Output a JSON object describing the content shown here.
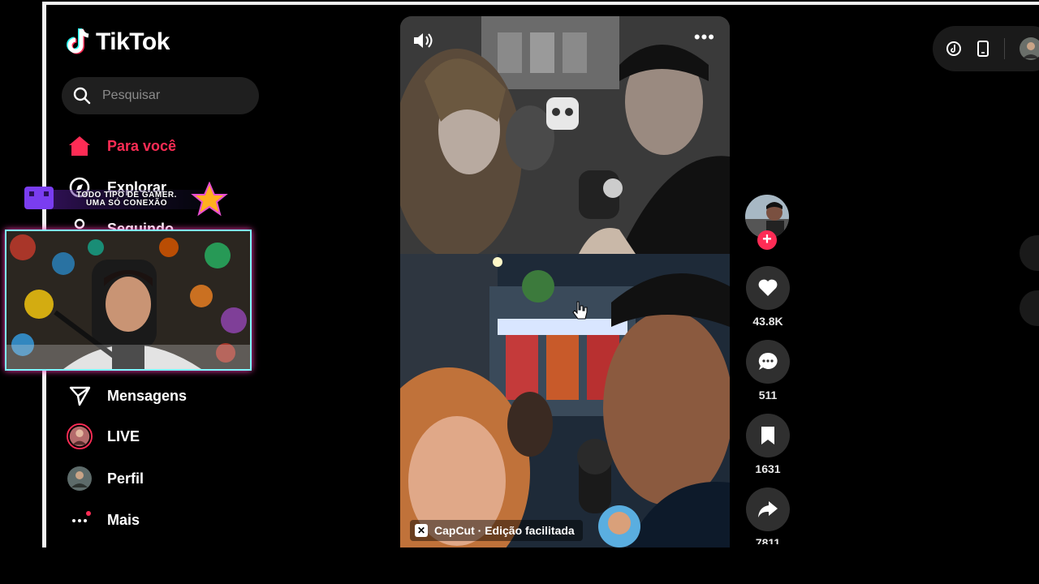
{
  "sidebar": {
    "logo_text": "TikTok",
    "search": {
      "placeholder": "Pesquisar",
      "value": ""
    },
    "items": [
      {
        "label": "Para você",
        "icon": "home-icon",
        "active": true
      },
      {
        "label": "Explorar",
        "icon": "compass-icon"
      },
      {
        "label": "Seguindo",
        "icon": "following-icon"
      },
      {
        "label": "Mensagens",
        "icon": "send-icon"
      },
      {
        "label": "LIVE",
        "icon": "live-avatar"
      },
      {
        "label": "Perfil",
        "icon": "profile-avatar"
      },
      {
        "label": "Mais",
        "icon": "more-dots-icon"
      }
    ]
  },
  "video": {
    "watermark": "CapCut · Edição facilitada"
  },
  "actions": {
    "likes": "43.8K",
    "comments": "511",
    "saves": "1631",
    "shares": "7811"
  },
  "stream_overlay": {
    "text_line1": "TODO TIPO DE GAMER.",
    "text_line2": "UMA SÓ CONEXÃO"
  },
  "colors": {
    "accent": "#fe2c55",
    "background": "#000000",
    "webcam_border": "#7ff5ff"
  }
}
